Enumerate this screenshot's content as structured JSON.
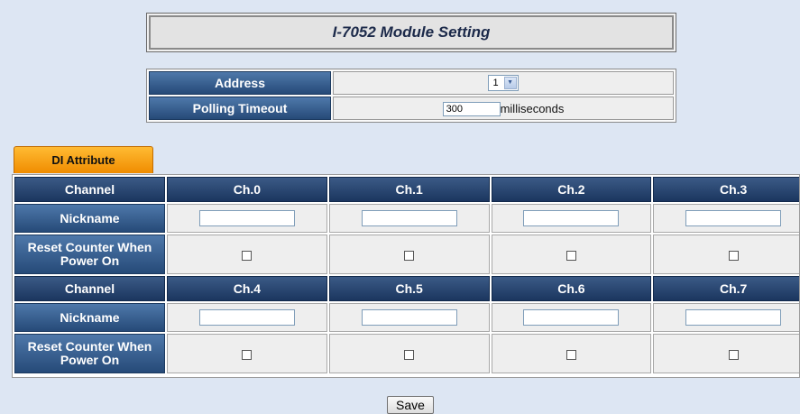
{
  "page": {
    "title": "I-7052 Module Setting"
  },
  "settings": {
    "address_label": "Address",
    "address_value": "1",
    "polling_label": "Polling Timeout",
    "polling_value": "300",
    "polling_unit": "milliseconds"
  },
  "tab": {
    "label": "DI Attribute"
  },
  "di": {
    "channel_label": "Channel",
    "nickname_label": "Nickname",
    "reset_label": "Reset Counter When Power On",
    "groups": [
      {
        "channels": [
          "Ch.0",
          "Ch.1",
          "Ch.2",
          "Ch.3"
        ]
      },
      {
        "channels": [
          "Ch.4",
          "Ch.5",
          "Ch.6",
          "Ch.7"
        ]
      }
    ]
  },
  "save": {
    "label": "Save"
  }
}
